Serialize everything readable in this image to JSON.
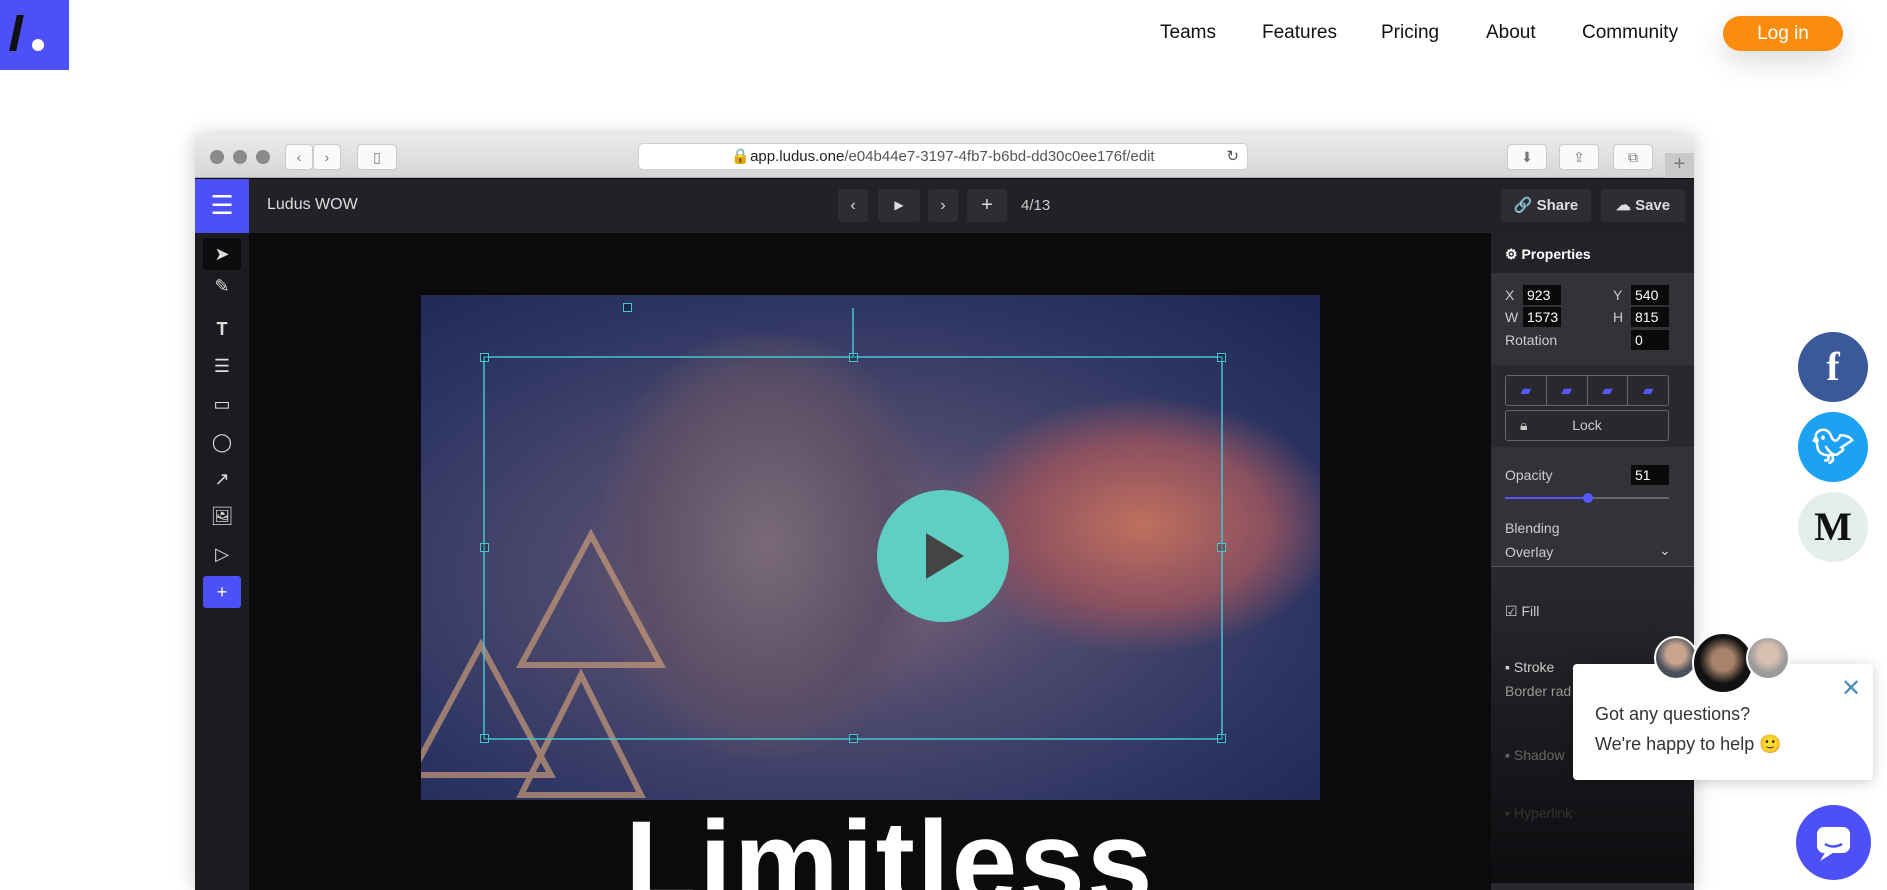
{
  "site": {
    "nav": [
      "Teams",
      "Features",
      "Pricing",
      "About",
      "Community"
    ],
    "login": "Log in",
    "accent": "#4d50f6",
    "cta_color": "#fb8c0e"
  },
  "browser": {
    "url_host": "app.ludus.one",
    "url_path": "/e04b44e7-3197-4fb7-b6bd-dd30c0ee176f/edit"
  },
  "app": {
    "title": "Ludus WOW",
    "slide_counter": "4/13",
    "share": "Share",
    "save": "Save",
    "tools": [
      "pointer",
      "pen",
      "text",
      "list",
      "rectangle",
      "circle",
      "arrow",
      "image",
      "video",
      "add"
    ],
    "properties": {
      "title": "Properties",
      "x_label": "X",
      "x": "923",
      "y_label": "Y",
      "y": "540",
      "w_label": "W",
      "w": "1573",
      "h_label": "H",
      "h": "815",
      "rotation_label": "Rotation",
      "rotation": "0",
      "lock": "Lock",
      "opacity_label": "Opacity",
      "opacity": "51",
      "blending_label": "Blending",
      "blending": "Overlay",
      "fill": "Fill",
      "stroke": "Stroke",
      "border_radius": "Border rad",
      "shadow": "Shadow",
      "hyperlink": "Hyperlink"
    },
    "slide_text": "Limitless"
  },
  "social": {
    "facebook": "f",
    "medium": "M"
  },
  "chat": {
    "line1": "Got any questions?",
    "line2": "We're happy to help 🙂"
  }
}
